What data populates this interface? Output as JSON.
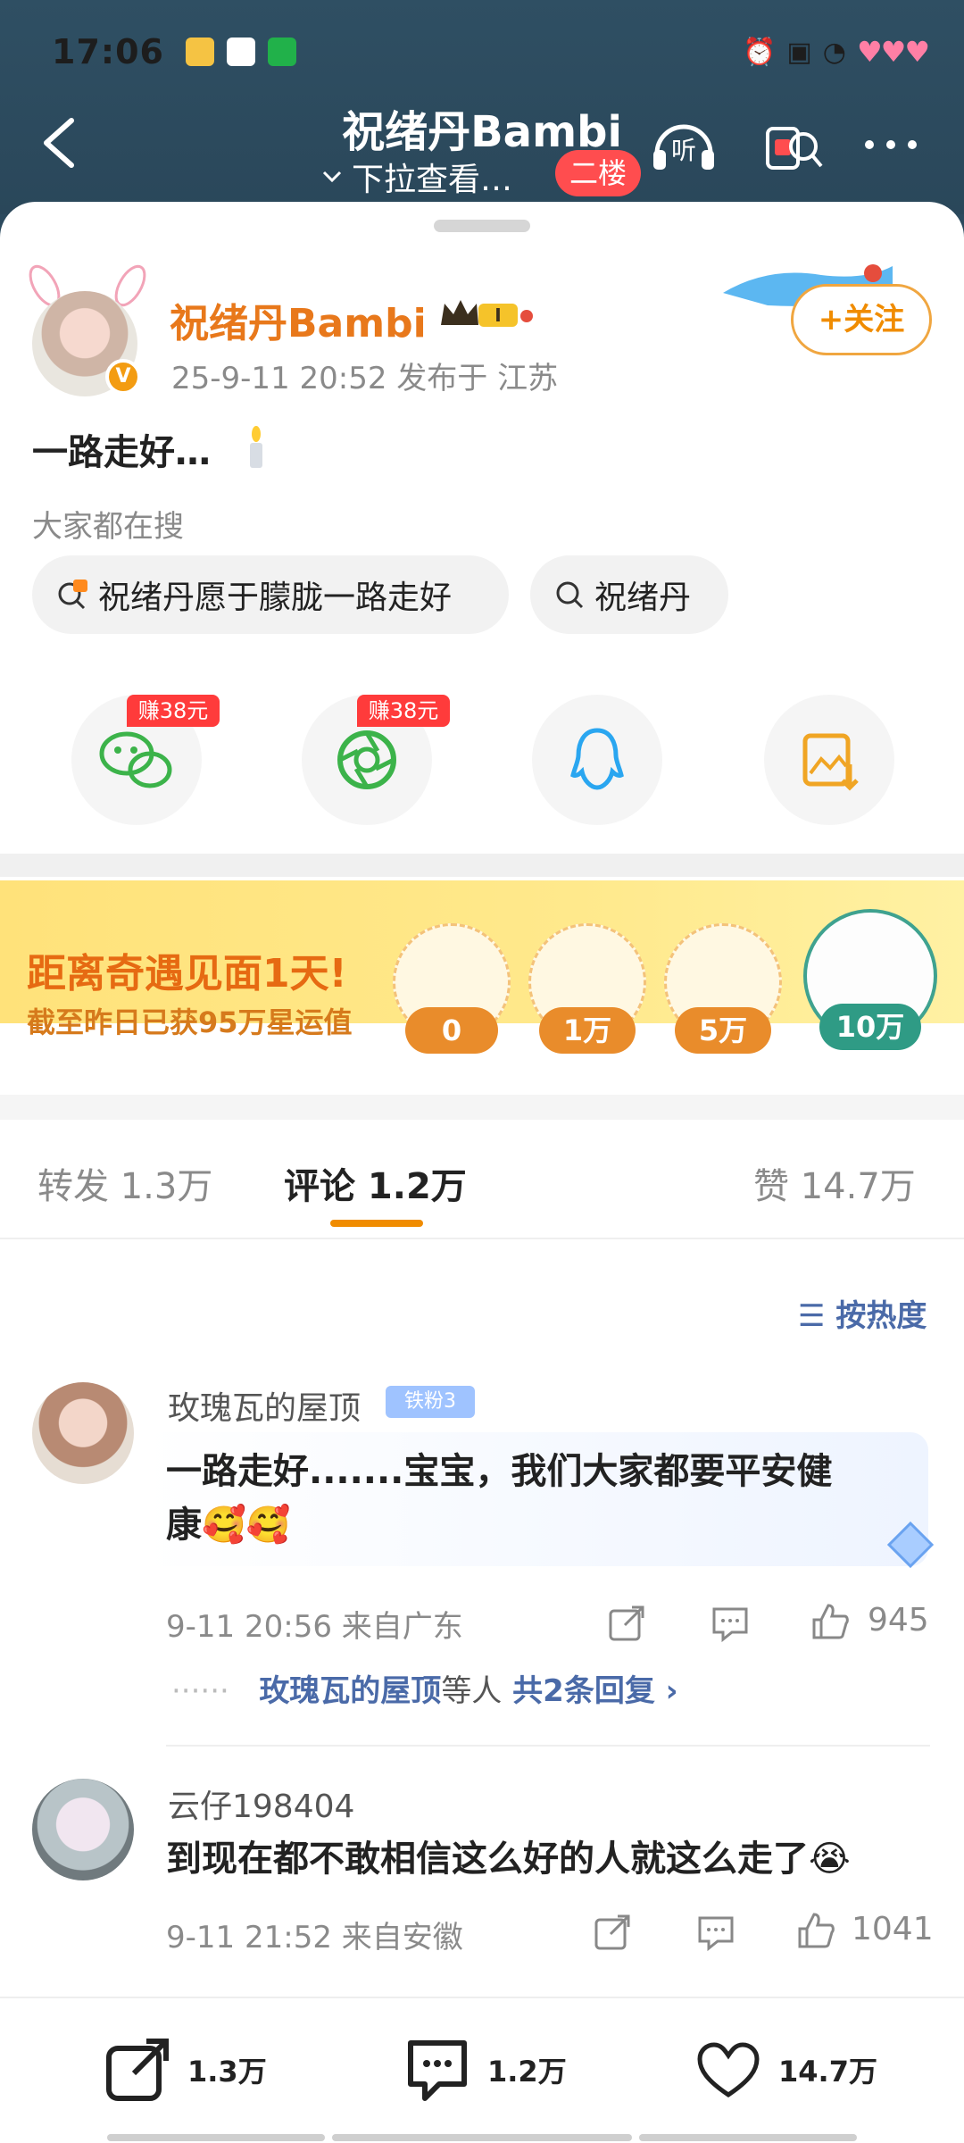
{
  "status_bar": {
    "time": "17:06"
  },
  "header": {
    "title": "祝绪丹Bambi",
    "subtitle": "下拉查看…",
    "floor_tag": "二楼"
  },
  "post": {
    "author": "祝绪丹Bambi",
    "meta": "25-9-11 20:52  发布于 江苏",
    "follow_label": "+关注",
    "text": "一路走好…",
    "searching_label": "大家都在搜",
    "search_chips": [
      "祝绪丹愿于朦胧一路走好",
      "祝绪丹"
    ],
    "share_earn_tags": [
      "赚38元",
      "赚38元"
    ]
  },
  "banner": {
    "title": "距离奇遇见面1天!",
    "subtitle": "截至昨日已获95万星运值",
    "milestones": [
      "0",
      "1万",
      "5万",
      "10万"
    ]
  },
  "tabs": {
    "repost": "转发 1.3万",
    "comment": "评论 1.2万",
    "like": "赞 14.7万"
  },
  "sort_label": "按热度",
  "comments": [
    {
      "name": "玫瑰瓦的屋顶",
      "fan_tag": "铁粉3",
      "text_line1": "一路走好.......宝宝，我们大家都要平安健",
      "text_line2": "康🥰🥰",
      "meta": "9-11 20:56  来自广东",
      "likes": "945",
      "reply_name": "玫瑰瓦的屋顶",
      "reply_mid": "等人",
      "reply_count": "共2条回复"
    },
    {
      "name": "云仔198404",
      "text_line1": "到现在都不敢相信这么好的人就这么走了😭",
      "meta": "9-11 21:52  来自安徽",
      "likes": "1041"
    }
  ],
  "bottom_bar": {
    "repost": "1.3万",
    "comment": "1.2万",
    "like": "14.7万"
  }
}
